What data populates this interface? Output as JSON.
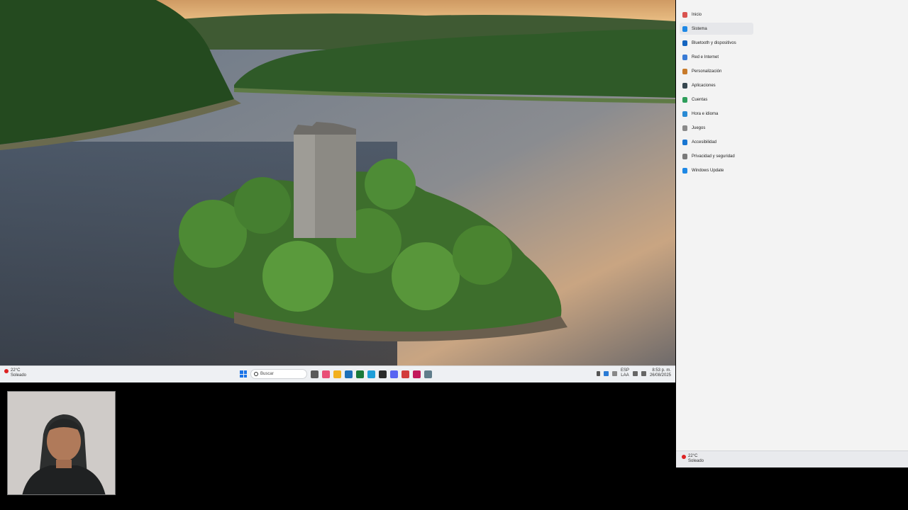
{
  "settings": {
    "nav_items": [
      {
        "label": "Inicio",
        "icon": "home-icon",
        "color": "#d9534f",
        "active": false
      },
      {
        "label": "Sistema",
        "icon": "system-icon",
        "color": "#1e88e5",
        "active": true
      },
      {
        "label": "Bluetooth y dispositivos",
        "icon": "bluetooth-icon",
        "color": "#1565c0",
        "active": false
      },
      {
        "label": "Red e Internet",
        "icon": "network-icon",
        "color": "#3a7bd5",
        "active": false
      },
      {
        "label": "Personalización",
        "icon": "personalization-icon",
        "color": "#c77a2a",
        "active": false
      },
      {
        "label": "Aplicaciones",
        "icon": "apps-icon",
        "color": "#37474f",
        "active": false
      },
      {
        "label": "Cuentas",
        "icon": "accounts-icon",
        "color": "#2e9e5b",
        "active": false
      },
      {
        "label": "Hora e idioma",
        "icon": "time-language-icon",
        "color": "#2a8ad4",
        "active": false
      },
      {
        "label": "Juegos",
        "icon": "gaming-icon",
        "color": "#8a8a8a",
        "active": false
      },
      {
        "label": "Accesibilidad",
        "icon": "accessibility-icon",
        "color": "#1976d2",
        "active": false
      },
      {
        "label": "Privacidad y seguridad",
        "icon": "shield-icon",
        "color": "#7a7a7a",
        "active": false
      },
      {
        "label": "Windows Update",
        "icon": "windows-update-icon",
        "color": "#1e88e5",
        "active": false
      }
    ]
  },
  "taskbar": {
    "weather_temp": "22°C",
    "weather_desc": "Soleado",
    "search_placeholder": "Buscar",
    "lang_top": "ESP",
    "lang_bottom": "LAA",
    "time": "8:53 p. m.",
    "date": "26/08/2025"
  },
  "settings_taskbar": {
    "weather_temp": "22°C",
    "weather_desc": "Soleado"
  },
  "colors": {
    "accent": "#1a73e8"
  }
}
